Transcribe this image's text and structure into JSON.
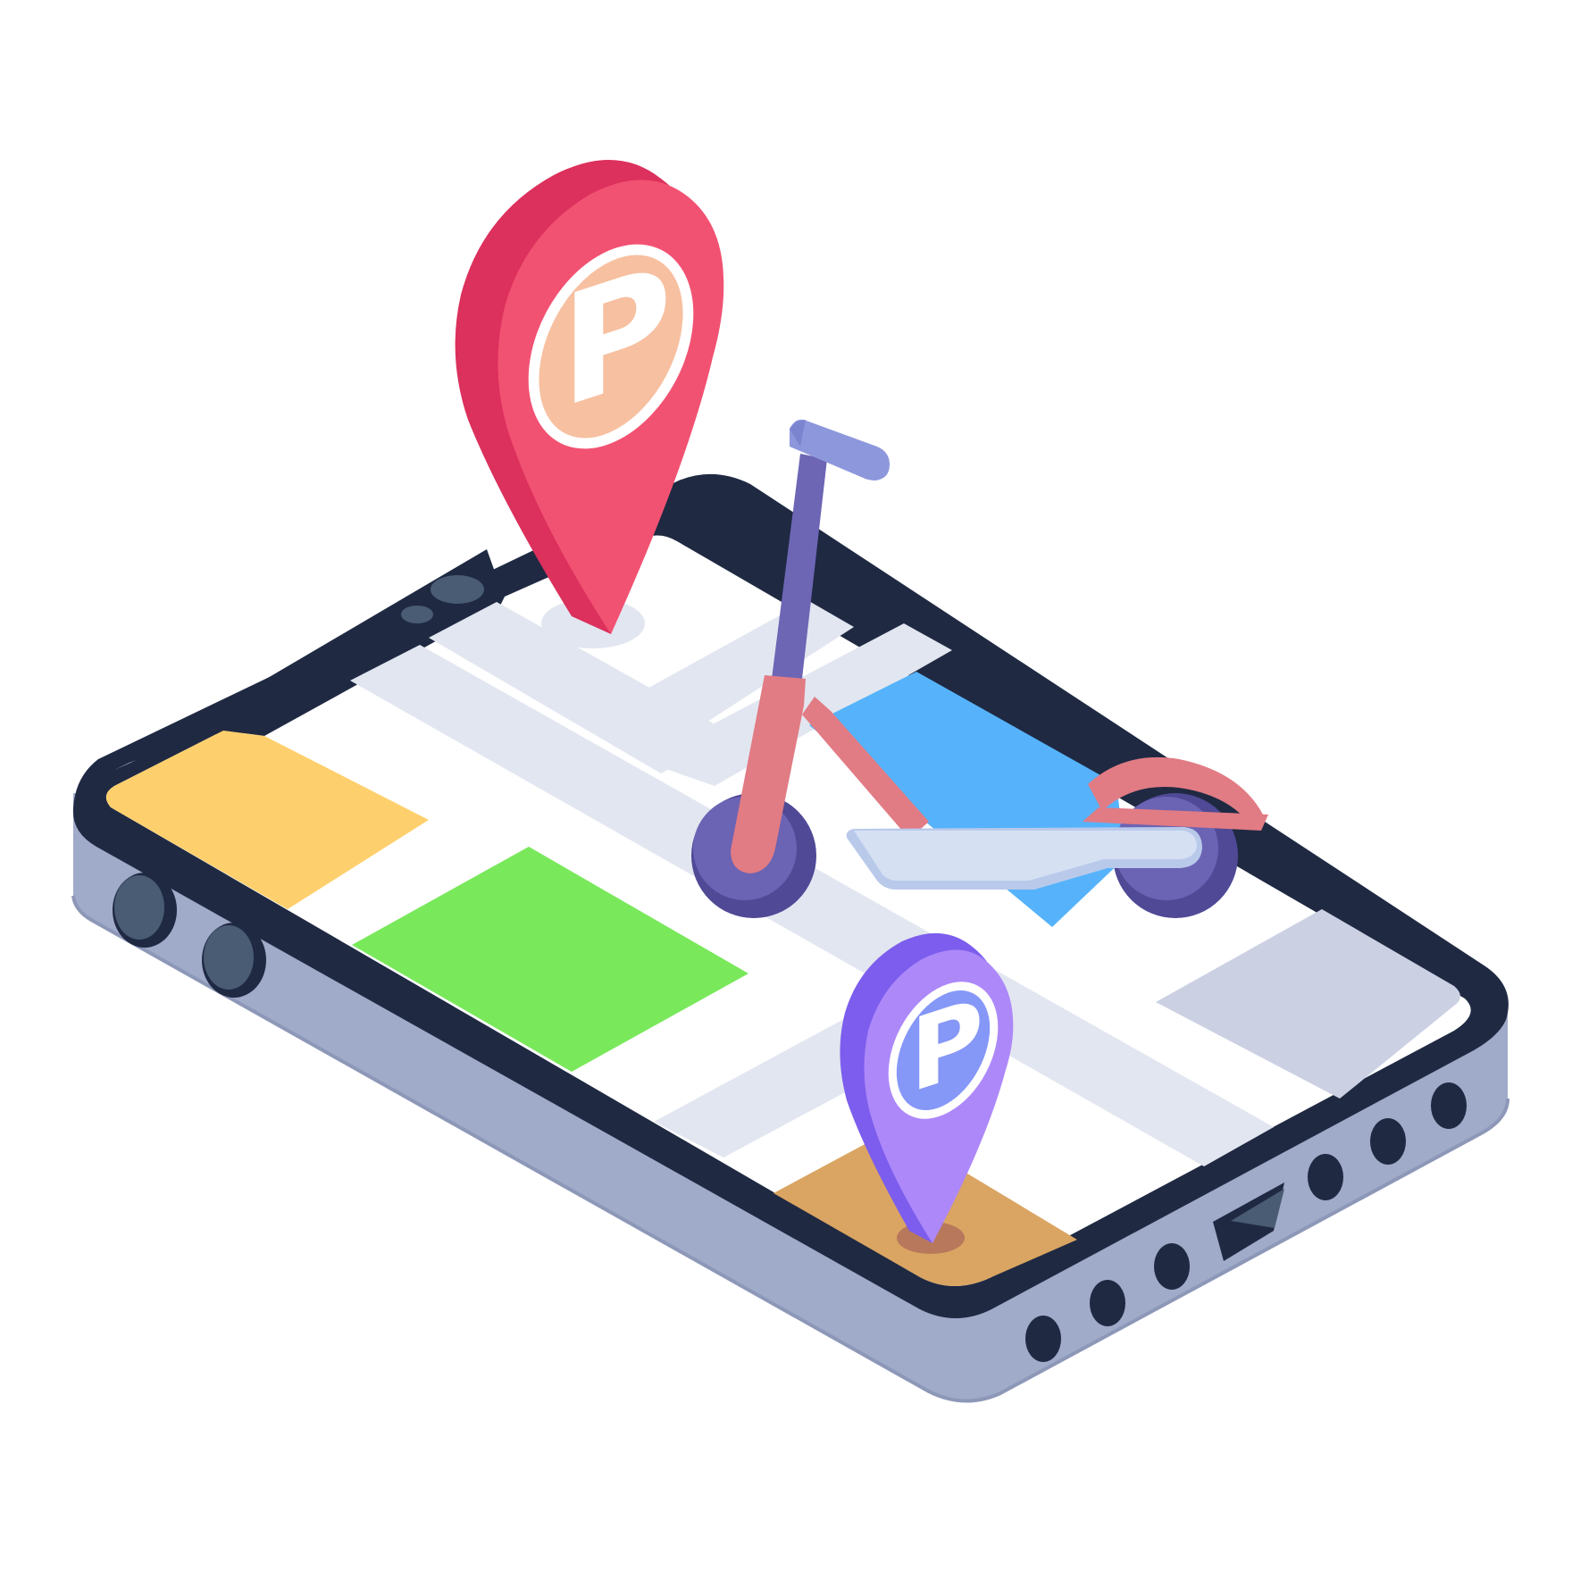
{
  "illustration": {
    "pins": [
      {
        "letter": "P",
        "color": "#f25272",
        "shade": "#dc305d",
        "badge": "#f7c0a1"
      },
      {
        "letter": "P",
        "color": "#ad88f9",
        "shade": "#7c5ded",
        "badge": "#8597f7"
      }
    ],
    "palette": {
      "phone_frame": "#1f2942",
      "phone_body": "#a0aac9",
      "screen": "#ffffff",
      "road": "#e2e6f0",
      "block_yellow": "#fed06d",
      "block_green": "#79e85b",
      "block_blue": "#56b3fb",
      "block_orange": "#daa562",
      "block_grey": "#cbd0e3",
      "scooter_stem": "#6d66b5",
      "scooter_frame": "#e17b84",
      "scooter_deck": "#d5e0f3",
      "scooter_handle": "#8d97dc",
      "wheel": "#6b63b3",
      "wheel_shade": "#4f4996"
    },
    "icons": [
      "smartphone-icon",
      "parking-pin-icon",
      "e-scooter-icon",
      "map-icon"
    ]
  }
}
